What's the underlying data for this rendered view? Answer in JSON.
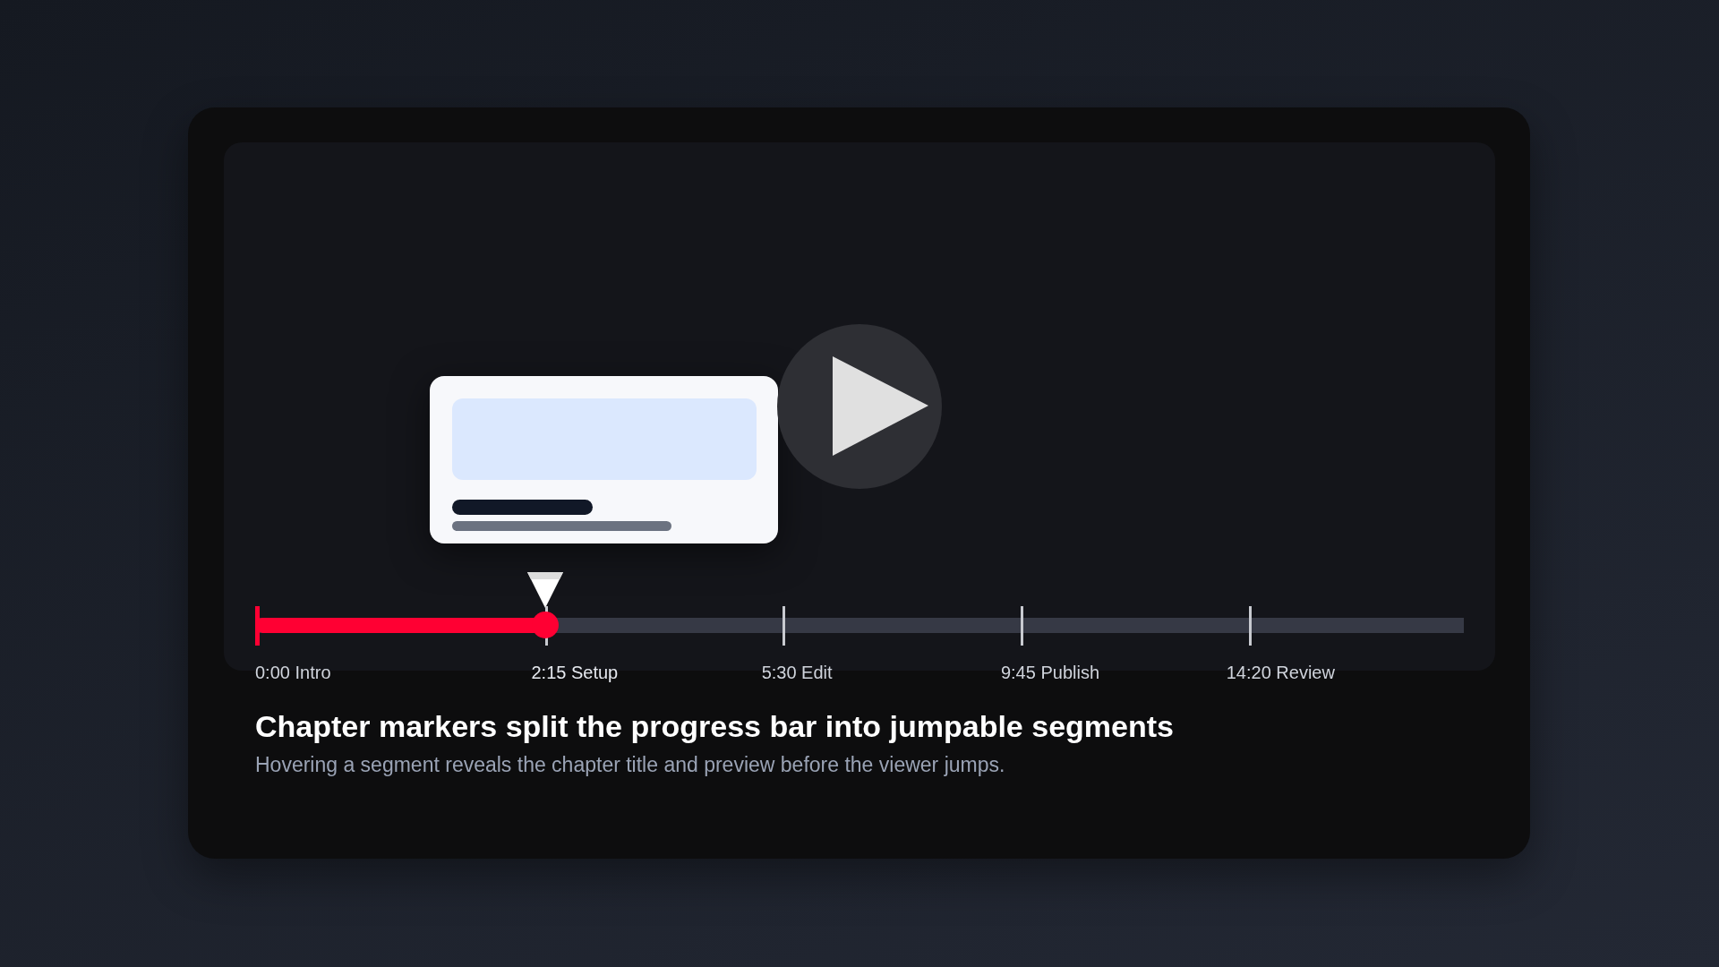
{
  "player": {
    "progress": {
      "level": 0.24
    },
    "chapters": [
      {
        "time": "0:00",
        "title": "Intro",
        "selected": false
      },
      {
        "time": "2:15",
        "title": "Setup",
        "selected": true
      },
      {
        "time": "5:30",
        "title": "Edit",
        "selected": false
      },
      {
        "time": "9:45",
        "title": "Publish",
        "selected": false
      },
      {
        "time": "14:20",
        "title": "Review",
        "selected": false
      }
    ]
  },
  "heading": "Chapter markers split the progress bar into jumpable segments",
  "description": "Hovering a segment reveals the chapter title and preview before the viewer jumps."
}
